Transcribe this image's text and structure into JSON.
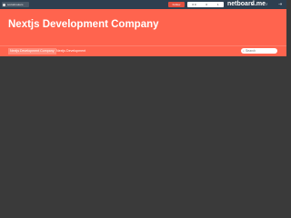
{
  "topbar": {
    "user_label": "socialmakers",
    "follow_label": "Follow",
    "stats": [
      "0 0",
      "0",
      "1"
    ],
    "brand": "netboard.me"
  },
  "header": {
    "title": "Nextjs Development Company"
  },
  "nav": {
    "items": [
      "Nextjs Development Company",
      "Nextjs Development"
    ],
    "search_placeholder": "Search"
  },
  "colors": {
    "topbar": "#2e3f50",
    "header": "#ff644e",
    "content": "#3a3a3a"
  }
}
